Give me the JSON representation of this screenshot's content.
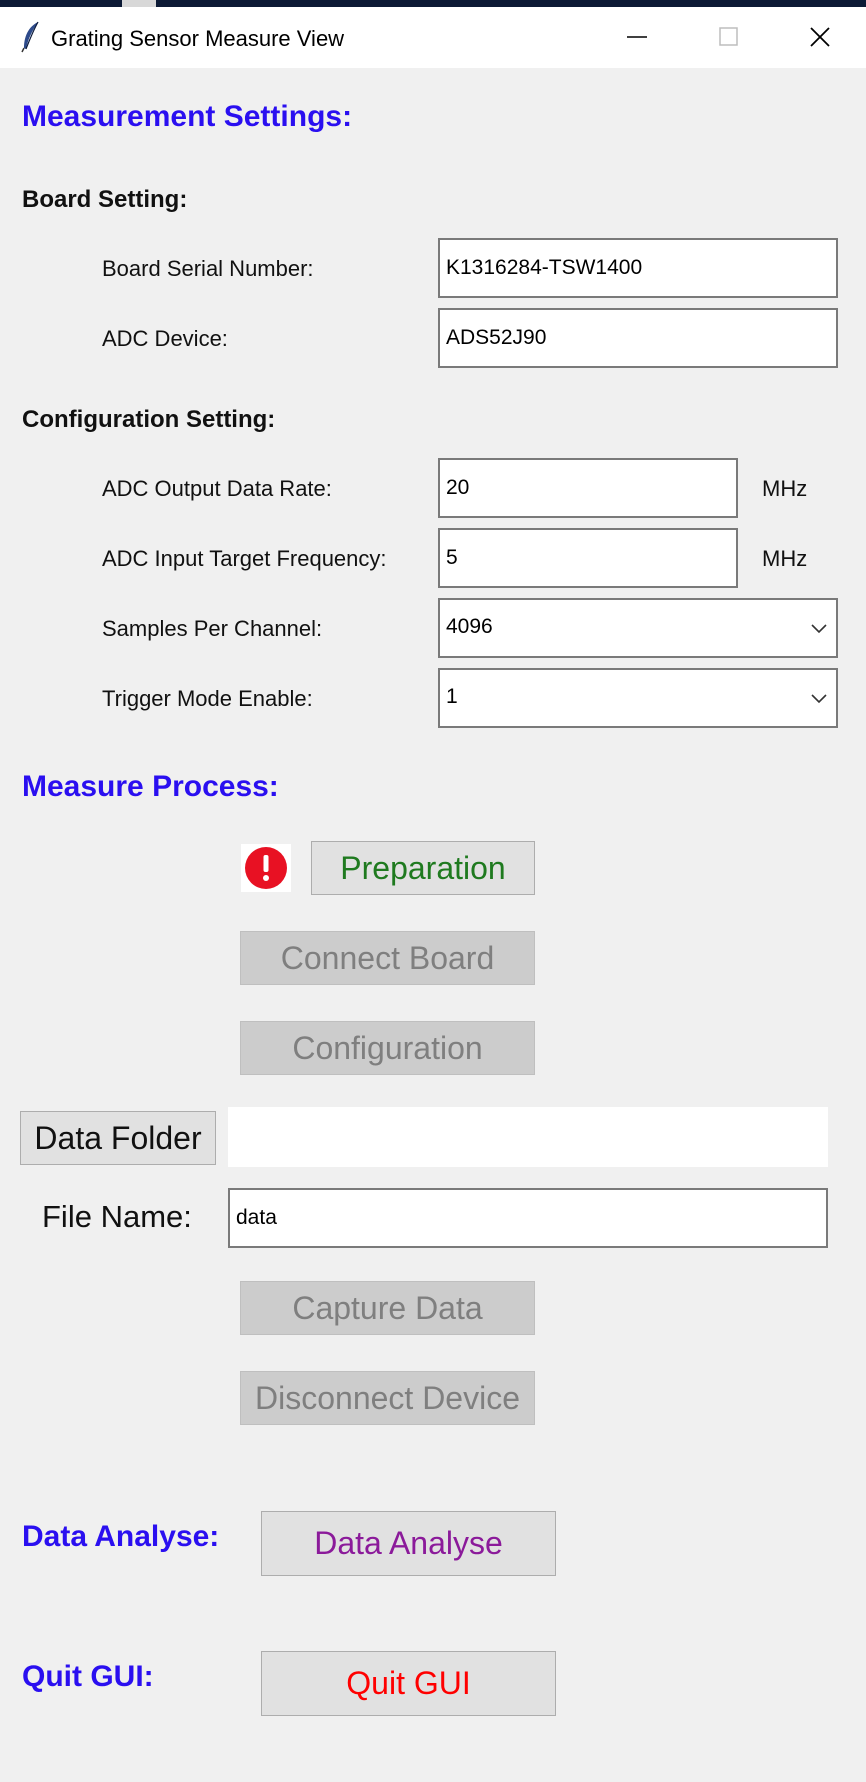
{
  "window": {
    "title": "Grating Sensor Measure View",
    "icon": "feather-icon",
    "controls": [
      "minimize-icon",
      "maximize-icon",
      "close-icon"
    ]
  },
  "measurement_settings": {
    "heading": "Measurement Settings:",
    "board_setting": {
      "heading": "Board Setting:",
      "serial_label": "Board Serial Number:",
      "serial_value": "K1316284-TSW1400",
      "adc_device_label": "ADC Device:",
      "adc_device_value": "ADS52J90"
    },
    "configuration_setting": {
      "heading": "Configuration Setting:",
      "output_rate_label": "ADC Output Data Rate:",
      "output_rate_value": "20",
      "output_rate_unit": "MHz",
      "input_freq_label": "ADC Input Target Frequency:",
      "input_freq_value": "5",
      "input_freq_unit": "MHz",
      "samples_label": "Samples Per Channel:",
      "samples_value": "4096",
      "trigger_label": "Trigger Mode Enable:",
      "trigger_value": "1"
    }
  },
  "measure_process": {
    "heading": "Measure Process:",
    "status_icon": "error-icon",
    "preparation_label": "Preparation",
    "connect_board_label": "Connect Board",
    "configuration_label": "Configuration",
    "data_folder_label": "Data Folder",
    "data_folder_value": "",
    "file_name_label": "File Name:",
    "file_name_value": "data",
    "capture_label": "Capture Data",
    "disconnect_label": "Disconnect Device"
  },
  "data_analyse": {
    "heading": "Data Analyse:",
    "button_label": "Data Analyse"
  },
  "quit": {
    "heading": "Quit GUI:",
    "button_label": "Quit GUI"
  },
  "colors": {
    "section_heading": "#2a0ff0",
    "preparation_text": "#1f7a1f",
    "data_analyse_text": "#8b1a9a",
    "quit_text": "#ff0000",
    "error_icon": "#e81123"
  }
}
